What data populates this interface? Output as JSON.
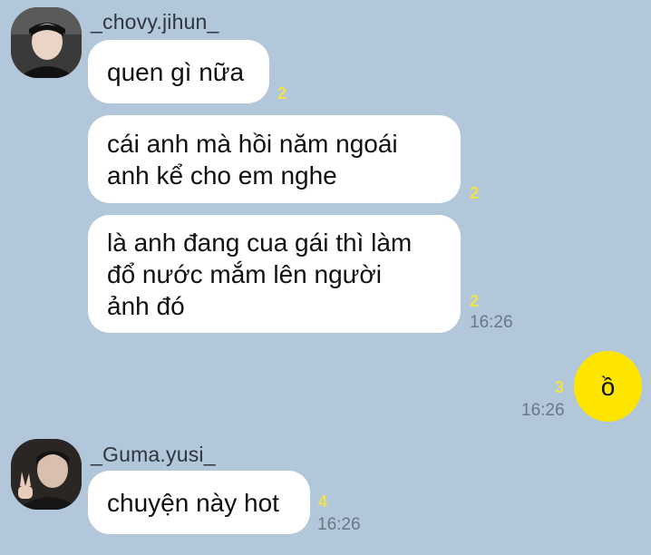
{
  "chat": {
    "groups": [
      {
        "sender": "_chovy.jihun_",
        "messages": [
          {
            "text": "quen gì nữa",
            "unread": "2"
          },
          {
            "text": "cái anh mà hồi năm ngoái\nanh kể cho em nghe",
            "unread": "2"
          },
          {
            "text": "là anh đang cua gái thì làm\nđổ nước mắm lên người\nảnh đó",
            "unread": "2",
            "time": "16:26"
          }
        ]
      },
      {
        "sender": "me",
        "messages": [
          {
            "text": "ồ",
            "unread": "3",
            "time": "16:26"
          }
        ]
      },
      {
        "sender": "_Guma.yusi_",
        "messages": [
          {
            "text": "chuyện này hot",
            "unread": "4",
            "time": "16:26"
          }
        ]
      }
    ]
  },
  "colors": {
    "background": "#b2c7da",
    "incoming_bubble": "#ffffff",
    "outgoing_bubble": "#fee500",
    "unread_count": "#f2e24a",
    "timestamp": "#6b7785"
  },
  "icons": [
    "avatar-chovy-jihun",
    "avatar-guma-yusi"
  ]
}
